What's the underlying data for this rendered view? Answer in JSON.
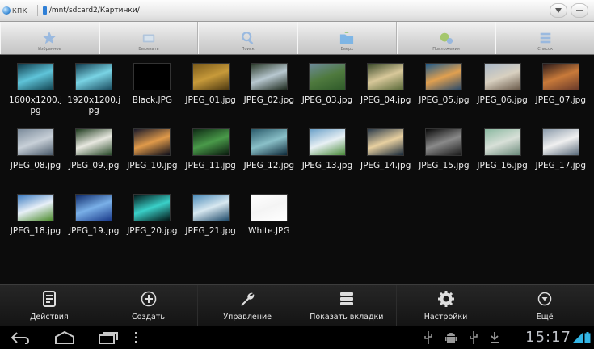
{
  "pathbar": {
    "app_name": "КПК",
    "path": "/mnt/sdcard2/Картинки/",
    "dropdown_icon": "chevron-down-icon",
    "minimize_icon": "minus-icon"
  },
  "toolbar": {
    "items": [
      {
        "label": "Избранное",
        "icon": "star-icon"
      },
      {
        "label": "Вырезать",
        "icon": "cut-icon"
      },
      {
        "label": "Поиск",
        "icon": "search-icon"
      },
      {
        "label": "Вверх",
        "icon": "folder-up-icon"
      },
      {
        "label": "Приложения",
        "icon": "apps-icon"
      },
      {
        "label": "Список",
        "icon": "list-icon"
      }
    ]
  },
  "files": [
    {
      "name": "1600x1200.jpg",
      "colors": [
        "#0e3a4a",
        "#5fc4d9",
        "#134552"
      ]
    },
    {
      "name": "1920x1200.jpg",
      "colors": [
        "#113b4d",
        "#79d3e4",
        "#1b4d60"
      ]
    },
    {
      "name": "Black.JPG",
      "colors": [
        "#000000",
        "#000000",
        "#000000"
      ]
    },
    {
      "name": "JPEG_01.jpg",
      "colors": [
        "#7a5a1a",
        "#c79a3a",
        "#4e3a12"
      ]
    },
    {
      "name": "JPEG_02.jpg",
      "colors": [
        "#2b3a2a",
        "#b8c8d0",
        "#1e2a1e"
      ]
    },
    {
      "name": "JPEG_03.jpg",
      "colors": [
        "#6c8a9a",
        "#4f7a3e",
        "#2f5a2a"
      ]
    },
    {
      "name": "JPEG_04.jpg",
      "colors": [
        "#3a4a2a",
        "#d8c89a",
        "#5a6a3a"
      ]
    },
    {
      "name": "JPEG_05.jpg",
      "colors": [
        "#1f5a8a",
        "#e0a050",
        "#2a4a6a"
      ]
    },
    {
      "name": "JPEG_06.jpg",
      "colors": [
        "#aab8c8",
        "#d8d0c0",
        "#6a5a4a"
      ]
    },
    {
      "name": "JPEG_07.jpg",
      "colors": [
        "#2a1a1a",
        "#c87a3a",
        "#6a3a2a"
      ]
    },
    {
      "name": "JPEG_08.jpg",
      "colors": [
        "#7a8a9a",
        "#c8d0d8",
        "#4a5a6a"
      ]
    },
    {
      "name": "JPEG_09.jpg",
      "colors": [
        "#1e3a1e",
        "#e8e8e0",
        "#2a4a2a"
      ]
    },
    {
      "name": "JPEG_10.jpg",
      "colors": [
        "#1a1a2a",
        "#e09a4a",
        "#0e0e1a"
      ]
    },
    {
      "name": "JPEG_11.jpg",
      "colors": [
        "#0e2a14",
        "#4a9a4a",
        "#0a1a0e"
      ]
    },
    {
      "name": "JPEG_12.jpg",
      "colors": [
        "#2a5a6a",
        "#8ac0c8",
        "#0e2a3a"
      ]
    },
    {
      "name": "JPEG_13.jpg",
      "colors": [
        "#6aa0c8",
        "#e8f0f4",
        "#4a8a3a"
      ]
    },
    {
      "name": "JPEG_14.jpg",
      "colors": [
        "#2a3a4a",
        "#e8d0a0",
        "#1a2a3a"
      ]
    },
    {
      "name": "JPEG_15.jpg",
      "colors": [
        "#0a0a0a",
        "#8a8a8a",
        "#1a1a1a"
      ]
    },
    {
      "name": "JPEG_16.jpg",
      "colors": [
        "#8ab8a0",
        "#d8e0d8",
        "#6a8a7a"
      ]
    },
    {
      "name": "JPEG_17.jpg",
      "colors": [
        "#8a9aaa",
        "#f0f0f0",
        "#5a6a7a"
      ]
    },
    {
      "name": "JPEG_18.jpg",
      "colors": [
        "#3a7ac0",
        "#e8f0f8",
        "#4a8a2a"
      ]
    },
    {
      "name": "JPEG_19.jpg",
      "colors": [
        "#0e2a6a",
        "#7ab0e8",
        "#1a3a8a"
      ]
    },
    {
      "name": "JPEG_20.jpg",
      "colors": [
        "#021a1a",
        "#3ad0c8",
        "#021414"
      ]
    },
    {
      "name": "JPEG_21.jpg",
      "colors": [
        "#4a8ab8",
        "#d8e8f0",
        "#1e4a6a"
      ]
    },
    {
      "name": "White.JPG",
      "colors": [
        "#ffffff",
        "#f4f4f4",
        "#ffffff"
      ]
    }
  ],
  "actionbar": {
    "items": [
      {
        "label": "Действия",
        "icon": "actions-icon"
      },
      {
        "label": "Создать",
        "icon": "add-circle-icon"
      },
      {
        "label": "Управление",
        "icon": "wrench-icon"
      },
      {
        "label": "Показать вкладки",
        "icon": "tabs-stack-icon"
      },
      {
        "label": "Настройки",
        "icon": "gear-icon"
      },
      {
        "label": "Ещё",
        "icon": "more-circle-icon"
      }
    ]
  },
  "systembar": {
    "time": "15:17",
    "nav": [
      "back-icon",
      "home-icon",
      "recents-icon",
      "menu-dots-icon"
    ],
    "status_icons": [
      "usb-icon",
      "android-debug-icon",
      "usb-icon",
      "download-icon"
    ]
  }
}
